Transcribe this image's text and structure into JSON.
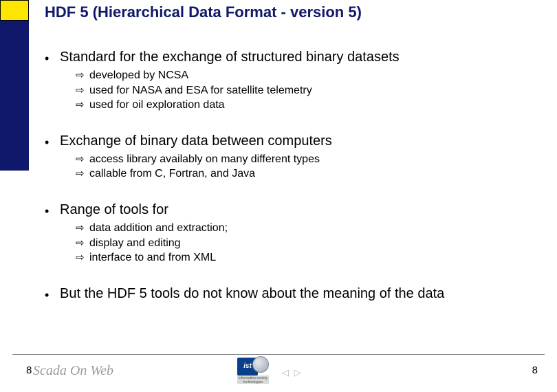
{
  "title": "HDF 5 (Hierarchical Data Format - version 5)",
  "points": [
    {
      "text": "Standard for the exchange of structured binary datasets",
      "subs": [
        "developed by NCSA",
        "used for NASA and ESA for satellite telemetry",
        "used for oil exploration data"
      ]
    },
    {
      "text": "Exchange of binary data between computers",
      "subs": [
        "access library availably on many different types",
        "callable from C, Fortran, and Java"
      ]
    },
    {
      "text": "Range of tools for",
      "subs": [
        "data addition and extraction;",
        "display and editing",
        "interface to and from  XML"
      ]
    },
    {
      "text": "But the HDF 5 tools do not know about the meaning of the data",
      "subs": []
    }
  ],
  "brand": "Scada On Web",
  "ist_label": "ist",
  "ist_sub": "information society technologies",
  "page_left": "8",
  "page_right": "8",
  "nav": "◁ ▷"
}
